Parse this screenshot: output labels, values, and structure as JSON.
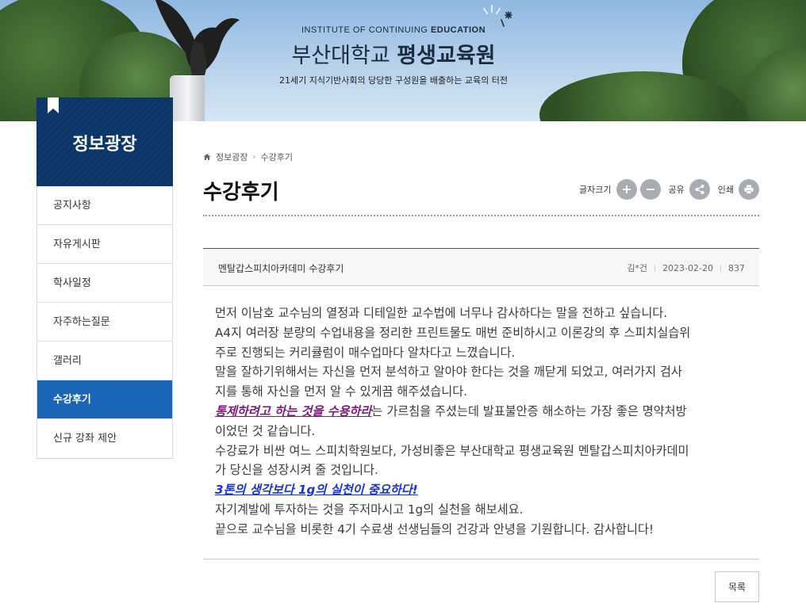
{
  "banner": {
    "institute_en_plain": "INSTITUTE OF CONTINUING ",
    "institute_en_bold": "EDUCATION",
    "institute_ko_plain": "부산대학교 ",
    "institute_ko_bold": "평생교육원",
    "tagline": "21세기 지식기반사회의 당당한 구성원을 배출하는 교육의 터전"
  },
  "sidebar": {
    "title": "정보광장",
    "items": [
      {
        "label": "공지사항",
        "active": false
      },
      {
        "label": "자유게시판",
        "active": false
      },
      {
        "label": "학사일정",
        "active": false
      },
      {
        "label": "자주하는질문",
        "active": false
      },
      {
        "label": "갤러리",
        "active": false
      },
      {
        "label": "수강후기",
        "active": true
      },
      {
        "label": "신규 강좌 제안",
        "active": false
      }
    ]
  },
  "breadcrumb": {
    "home_icon": "home-icon",
    "level1": "정보광장",
    "sep": "›",
    "level2": "수강후기"
  },
  "page": {
    "title": "수강후기"
  },
  "tools": {
    "font_size_label": "글자크기",
    "share_label": "공유",
    "print_label": "인쇄"
  },
  "post": {
    "title": "멘탈갑스피치아카데미 수강후기",
    "author": "김*건",
    "date": "2023-02-20",
    "views": "837",
    "lines": [
      "먼저 이남호 교수님의 열정과 디테일한 교수법에 너무나 감사하다는 말을 전하고 싶습니다.",
      "A4지 여러장 분량의 수업내용을 정리한 프린트물도 매번 준비하시고 이론강의 후 스피치실습위",
      "주로 진행되는 커리큘럼이 매수업마다 알차다고 느꼈습니다.",
      "말을 잘하기위해서는 자신을 먼저 분석하고 알아야 한다는 것을 깨닫게 되었고, 여러가지 검사",
      "지를 통해 자신을 먼저 알 수 있게끔 해주셨습니다."
    ],
    "emph1": "통제하려고 하는 것을 수용하라",
    "emph1_tail": "는 가르침을 주셨는데 발표불안증 해소하는 가장 좋은 명약처방",
    "lines2": [
      "이었던 것 같습니다.",
      "수강료가 비싼 여느 스피치학원보다, 가성비좋은 부산대학교 평생교육원 멘탈갑스피치아카데미",
      "가 당신을 성장시켜 줄 것입니다."
    ],
    "emph2": "3톤의 생각보다 1g의 실천이 중요하다!",
    "lines3": [
      "자기계발에 투자하는 것을 주저마시고 1g의 실천을 해보세요.",
      "끝으로 교수님을 비롯한 4기 수료생 선생님들의 건강과 안녕을 기원합니다. 감사합니다!"
    ]
  },
  "list_button": "목록",
  "colors": {
    "sidebar_head": "#0d3a6b",
    "active_menu": "#1b66b8",
    "emph_purple": "#7a1b7a",
    "emph_blue": "#1a36c8"
  }
}
